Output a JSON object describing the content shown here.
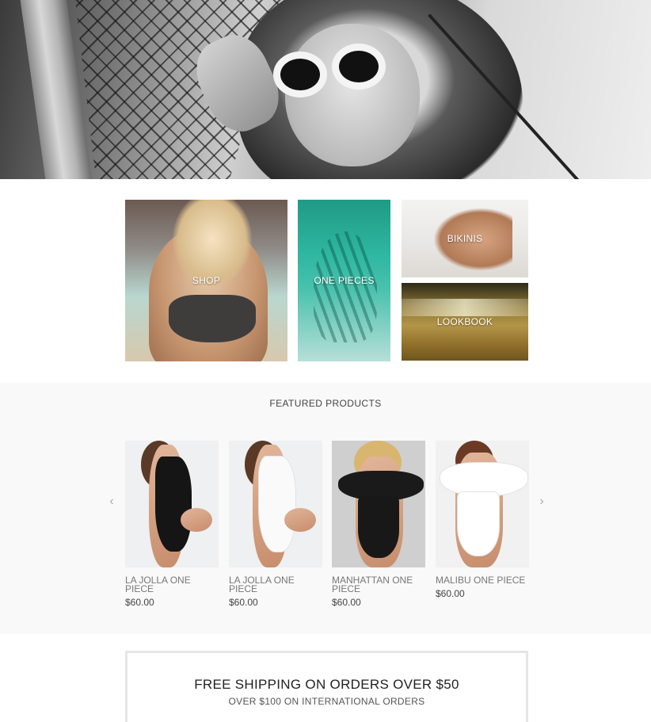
{
  "categories": {
    "shop": "SHOP",
    "one_pieces": "ONE PIECES",
    "bikinis": "BIKINIS",
    "lookbook": "LOOKBOOK"
  },
  "featured": {
    "title": "FEATURED PRODUCTS",
    "prev_icon": "‹",
    "next_icon": "›",
    "products": [
      {
        "name": "LA JOLLA ONE PIECE",
        "price": "$60.00"
      },
      {
        "name": "LA JOLLA ONE PIECE",
        "price": "$60.00"
      },
      {
        "name": "MANHATTAN ONE PIECE",
        "price": "$60.00"
      },
      {
        "name": "MALIBU ONE PIECE",
        "price": "$60.00"
      }
    ]
  },
  "shipping": {
    "headline": "FREE SHIPPING ON ORDERS OVER $50",
    "subline": "OVER $100 ON INTERNATIONAL ORDERS"
  }
}
